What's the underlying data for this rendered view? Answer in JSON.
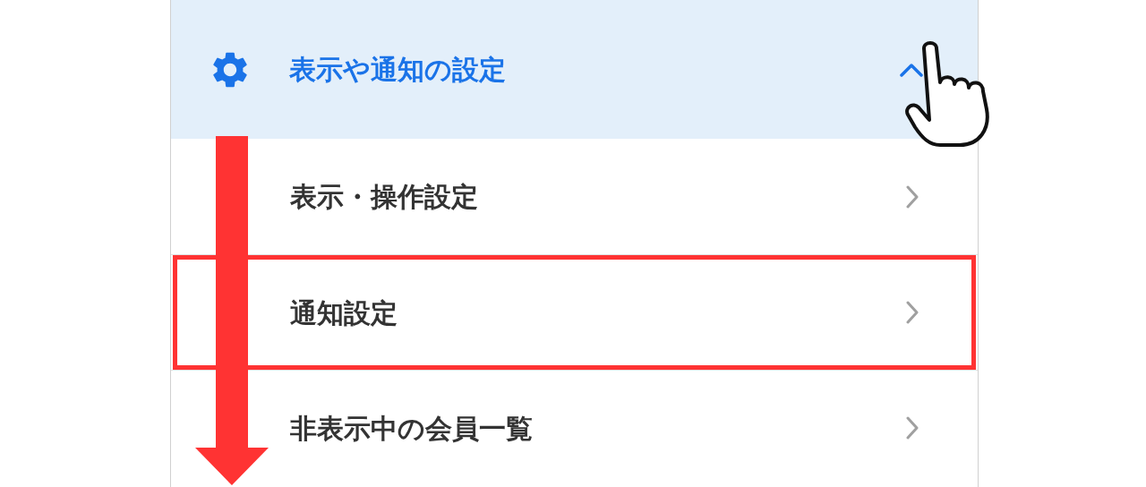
{
  "header": {
    "title": "表示や通知の設定",
    "expanded": true
  },
  "items": [
    {
      "label": "表示・操作設定",
      "highlighted": false
    },
    {
      "label": "通知設定",
      "highlighted": true
    },
    {
      "label": "非表示中の会員一覧",
      "highlighted": false
    }
  ]
}
